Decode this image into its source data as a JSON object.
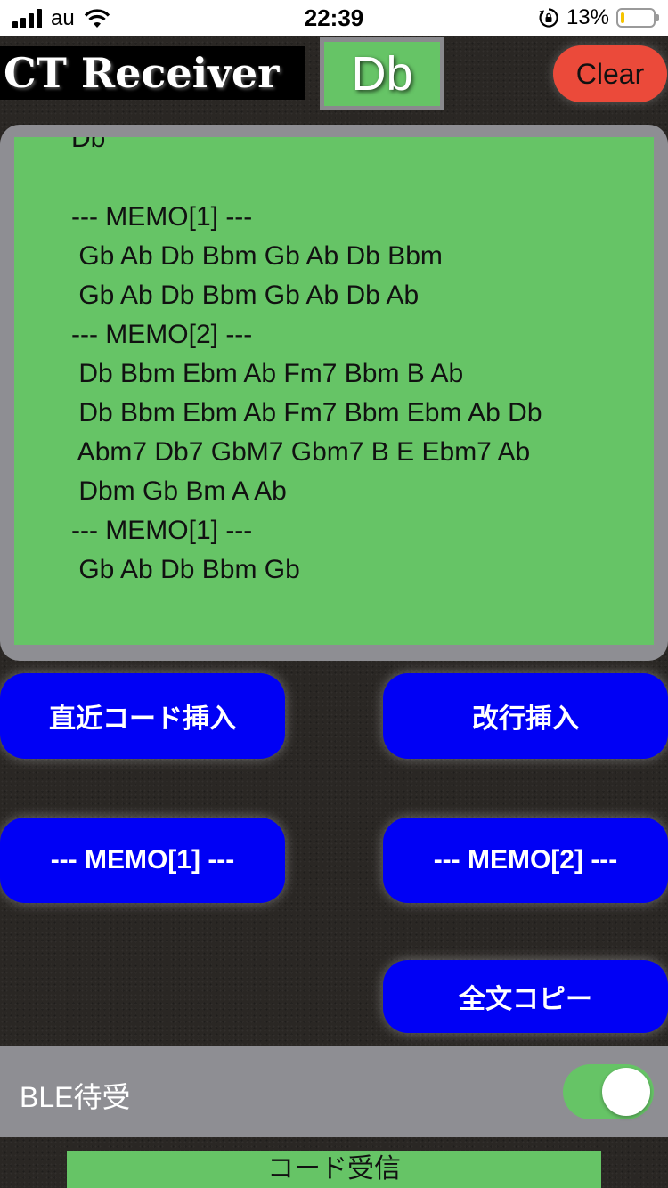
{
  "status_bar": {
    "carrier": "au",
    "time": "22:39",
    "battery_percent": "13%",
    "battery_level": 0.13,
    "icons": [
      "signal-icon",
      "wifi-icon",
      "rotation-lock-icon",
      "battery-icon"
    ]
  },
  "header": {
    "app_title": "CT Receiver",
    "current_key": "Db",
    "clear_label": "Clear"
  },
  "text_area": {
    "lines": [
      "Db",
      "",
      "--- MEMO[1] ---",
      " Gb Ab Db Bbm Gb Ab Db Bbm",
      " Gb Ab Db Bbm Gb Ab Db Ab",
      "--- MEMO[2] ---",
      " Db Bbm Ebm Ab Fm7 Bbm B Ab",
      " Db Bbm Ebm Ab Fm7 Bbm Ebm Ab Db",
      " Abm7 Db7 GbM7 Gbm7 B E Ebm7 Ab",
      " Dbm Gb Bm A Ab",
      "--- MEMO[1] ---",
      " Gb Ab Db Bbm Gb"
    ]
  },
  "buttons": {
    "insert_recent_chord": "直近コード挿入",
    "insert_newline": "改行挿入",
    "memo1": "--- MEMO[1] ---",
    "memo2": "--- MEMO[2] ---",
    "copy_all": "全文コピー"
  },
  "ble": {
    "label": "BLE待受",
    "enabled": true
  },
  "footer": {
    "chord_received": "コード受信"
  },
  "colors": {
    "accent_green": "#66c466",
    "button_blue": "#0000f5",
    "clear_red": "#eb4a3a",
    "frame_gray": "#8e8e93"
  }
}
